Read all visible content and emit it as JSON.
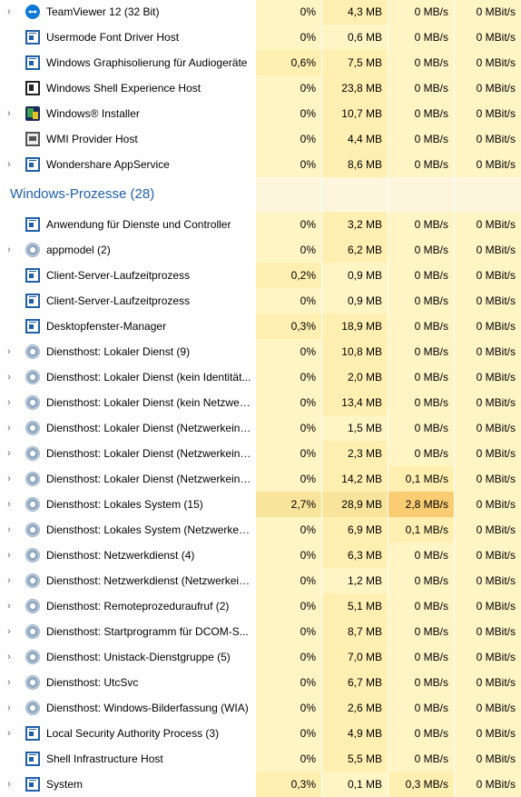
{
  "group": {
    "label": "Windows-Prozesse (28)"
  },
  "colors": {
    "heat0": "#fff4c4",
    "heat1": "#ffefb0",
    "heat2": "#f9e49b",
    "heat3": "#fbcd72",
    "group_bg": "#fdf6dd",
    "group_label": "#1e5fa8"
  },
  "rows_top": [
    {
      "name": "TeamViewer 12 (32 Bit)",
      "icon": "teamviewer-icon",
      "expand": true,
      "cpu": "0%",
      "mem": "4,3 MB",
      "disk": "0 MB/s",
      "net": "0 MBit/s",
      "heat": [
        0,
        1,
        0,
        0
      ]
    },
    {
      "name": "Usermode Font Driver Host",
      "icon": "app-window-icon",
      "expand": false,
      "cpu": "0%",
      "mem": "0,6 MB",
      "disk": "0 MB/s",
      "net": "0 MBit/s",
      "heat": [
        0,
        0,
        0,
        0
      ]
    },
    {
      "name": "Windows Graphisolierung für Audiogeräte",
      "icon": "app-window-icon",
      "expand": false,
      "cpu": "0,6%",
      "mem": "7,5 MB",
      "disk": "0 MB/s",
      "net": "0 MBit/s",
      "heat": [
        1,
        1,
        0,
        0
      ]
    },
    {
      "name": "Windows Shell Experience Host",
      "icon": "shell-window-icon",
      "expand": false,
      "cpu": "0%",
      "mem": "23,8 MB",
      "disk": "0 MB/s",
      "net": "0 MBit/s",
      "heat": [
        0,
        1,
        0,
        0
      ]
    },
    {
      "name": "Windows® Installer",
      "icon": "installer-icon",
      "expand": true,
      "cpu": "0%",
      "mem": "10,7 MB",
      "disk": "0 MB/s",
      "net": "0 MBit/s",
      "heat": [
        0,
        1,
        0,
        0
      ]
    },
    {
      "name": "WMI Provider Host",
      "icon": "wmi-icon",
      "expand": false,
      "cpu": "0%",
      "mem": "4,4 MB",
      "disk": "0 MB/s",
      "net": "0 MBit/s",
      "heat": [
        0,
        1,
        0,
        0
      ]
    },
    {
      "name": "Wondershare AppService",
      "icon": "app-window-icon",
      "expand": true,
      "cpu": "0%",
      "mem": "8,6 MB",
      "disk": "0 MB/s",
      "net": "0 MBit/s",
      "heat": [
        0,
        1,
        0,
        0
      ]
    }
  ],
  "rows_bottom": [
    {
      "name": "Anwendung für Dienste und Controller",
      "icon": "app-window-icon",
      "expand": false,
      "cpu": "0%",
      "mem": "3,2 MB",
      "disk": "0 MB/s",
      "net": "0 MBit/s",
      "heat": [
        0,
        1,
        0,
        0
      ]
    },
    {
      "name": "appmodel (2)",
      "icon": "gear-icon",
      "expand": true,
      "cpu": "0%",
      "mem": "6,2 MB",
      "disk": "0 MB/s",
      "net": "0 MBit/s",
      "heat": [
        0,
        1,
        0,
        0
      ]
    },
    {
      "name": "Client-Server-Laufzeitprozess",
      "icon": "app-window-icon",
      "expand": false,
      "cpu": "0,2%",
      "mem": "0,9 MB",
      "disk": "0 MB/s",
      "net": "0 MBit/s",
      "heat": [
        1,
        0,
        0,
        0
      ]
    },
    {
      "name": "Client-Server-Laufzeitprozess",
      "icon": "app-window-icon",
      "expand": false,
      "cpu": "0%",
      "mem": "0,9 MB",
      "disk": "0 MB/s",
      "net": "0 MBit/s",
      "heat": [
        0,
        0,
        0,
        0
      ]
    },
    {
      "name": "Desktopfenster-Manager",
      "icon": "app-window-icon",
      "expand": false,
      "cpu": "0,3%",
      "mem": "18,9 MB",
      "disk": "0 MB/s",
      "net": "0 MBit/s",
      "heat": [
        1,
        1,
        0,
        0
      ]
    },
    {
      "name": "Diensthost: Lokaler Dienst (9)",
      "icon": "gear-icon",
      "expand": true,
      "cpu": "0%",
      "mem": "10,8 MB",
      "disk": "0 MB/s",
      "net": "0 MBit/s",
      "heat": [
        0,
        1,
        0,
        0
      ]
    },
    {
      "name": "Diensthost: Lokaler Dienst (kein Identität...",
      "icon": "gear-icon",
      "expand": true,
      "cpu": "0%",
      "mem": "2,0 MB",
      "disk": "0 MB/s",
      "net": "0 MBit/s",
      "heat": [
        0,
        1,
        0,
        0
      ]
    },
    {
      "name": "Diensthost: Lokaler Dienst (kein Netzwer...",
      "icon": "gear-icon",
      "expand": true,
      "cpu": "0%",
      "mem": "13,4 MB",
      "disk": "0 MB/s",
      "net": "0 MBit/s",
      "heat": [
        0,
        1,
        0,
        0
      ]
    },
    {
      "name": "Diensthost: Lokaler Dienst (Netzwerkeins...",
      "icon": "gear-icon",
      "expand": true,
      "cpu": "0%",
      "mem": "1,5 MB",
      "disk": "0 MB/s",
      "net": "0 MBit/s",
      "heat": [
        0,
        0,
        0,
        0
      ]
    },
    {
      "name": "Diensthost: Lokaler Dienst (Netzwerkeins...",
      "icon": "gear-icon",
      "expand": true,
      "cpu": "0%",
      "mem": "2,3 MB",
      "disk": "0 MB/s",
      "net": "0 MBit/s",
      "heat": [
        0,
        1,
        0,
        0
      ]
    },
    {
      "name": "Diensthost: Lokaler Dienst (Netzwerkeins...",
      "icon": "gear-icon",
      "expand": true,
      "cpu": "0%",
      "mem": "14,2 MB",
      "disk": "0,1 MB/s",
      "net": "0 MBit/s",
      "heat": [
        0,
        1,
        1,
        0
      ]
    },
    {
      "name": "Diensthost: Lokales System (15)",
      "icon": "gear-icon",
      "expand": true,
      "cpu": "2,7%",
      "mem": "28,9 MB",
      "disk": "2,8 MB/s",
      "net": "0 MBit/s",
      "heat": [
        2,
        2,
        3,
        0
      ]
    },
    {
      "name": "Diensthost: Lokales System (Netzwerkein...",
      "icon": "gear-icon",
      "expand": true,
      "cpu": "0%",
      "mem": "6,9 MB",
      "disk": "0,1 MB/s",
      "net": "0 MBit/s",
      "heat": [
        0,
        1,
        1,
        0
      ]
    },
    {
      "name": "Diensthost: Netzwerkdienst (4)",
      "icon": "gear-icon",
      "expand": true,
      "cpu": "0%",
      "mem": "6,3 MB",
      "disk": "0 MB/s",
      "net": "0 MBit/s",
      "heat": [
        0,
        1,
        0,
        0
      ]
    },
    {
      "name": "Diensthost: Netzwerkdienst (Netzwerkein...",
      "icon": "gear-icon",
      "expand": true,
      "cpu": "0%",
      "mem": "1,2 MB",
      "disk": "0 MB/s",
      "net": "0 MBit/s",
      "heat": [
        0,
        0,
        0,
        0
      ]
    },
    {
      "name": "Diensthost: Remoteprozeduraufruf (2)",
      "icon": "gear-icon",
      "expand": true,
      "cpu": "0%",
      "mem": "5,1 MB",
      "disk": "0 MB/s",
      "net": "0 MBit/s",
      "heat": [
        0,
        1,
        0,
        0
      ]
    },
    {
      "name": "Diensthost: Startprogramm für DCOM-S...",
      "icon": "gear-icon",
      "expand": true,
      "cpu": "0%",
      "mem": "8,7 MB",
      "disk": "0 MB/s",
      "net": "0 MBit/s",
      "heat": [
        0,
        1,
        0,
        0
      ]
    },
    {
      "name": "Diensthost: Unistack-Dienstgruppe (5)",
      "icon": "gear-icon",
      "expand": true,
      "cpu": "0%",
      "mem": "7,0 MB",
      "disk": "0 MB/s",
      "net": "0 MBit/s",
      "heat": [
        0,
        1,
        0,
        0
      ]
    },
    {
      "name": "Diensthost: UtcSvc",
      "icon": "gear-icon",
      "expand": true,
      "cpu": "0%",
      "mem": "6,7 MB",
      "disk": "0 MB/s",
      "net": "0 MBit/s",
      "heat": [
        0,
        1,
        0,
        0
      ]
    },
    {
      "name": "Diensthost: Windows-Bilderfassung (WIA)",
      "icon": "gear-icon",
      "expand": true,
      "cpu": "0%",
      "mem": "2,6 MB",
      "disk": "0 MB/s",
      "net": "0 MBit/s",
      "heat": [
        0,
        1,
        0,
        0
      ]
    },
    {
      "name": "Local Security Authority Process (3)",
      "icon": "app-window-icon",
      "expand": true,
      "cpu": "0%",
      "mem": "4,9 MB",
      "disk": "0 MB/s",
      "net": "0 MBit/s",
      "heat": [
        0,
        1,
        0,
        0
      ]
    },
    {
      "name": "Shell Infrastructure Host",
      "icon": "app-window-icon",
      "expand": false,
      "cpu": "0%",
      "mem": "5,5 MB",
      "disk": "0 MB/s",
      "net": "0 MBit/s",
      "heat": [
        0,
        1,
        0,
        0
      ]
    },
    {
      "name": "System",
      "icon": "app-window-icon",
      "expand": true,
      "cpu": "0,3%",
      "mem": "0,1 MB",
      "disk": "0,3 MB/s",
      "net": "0 MBit/s",
      "heat": [
        1,
        0,
        1,
        0
      ]
    }
  ]
}
